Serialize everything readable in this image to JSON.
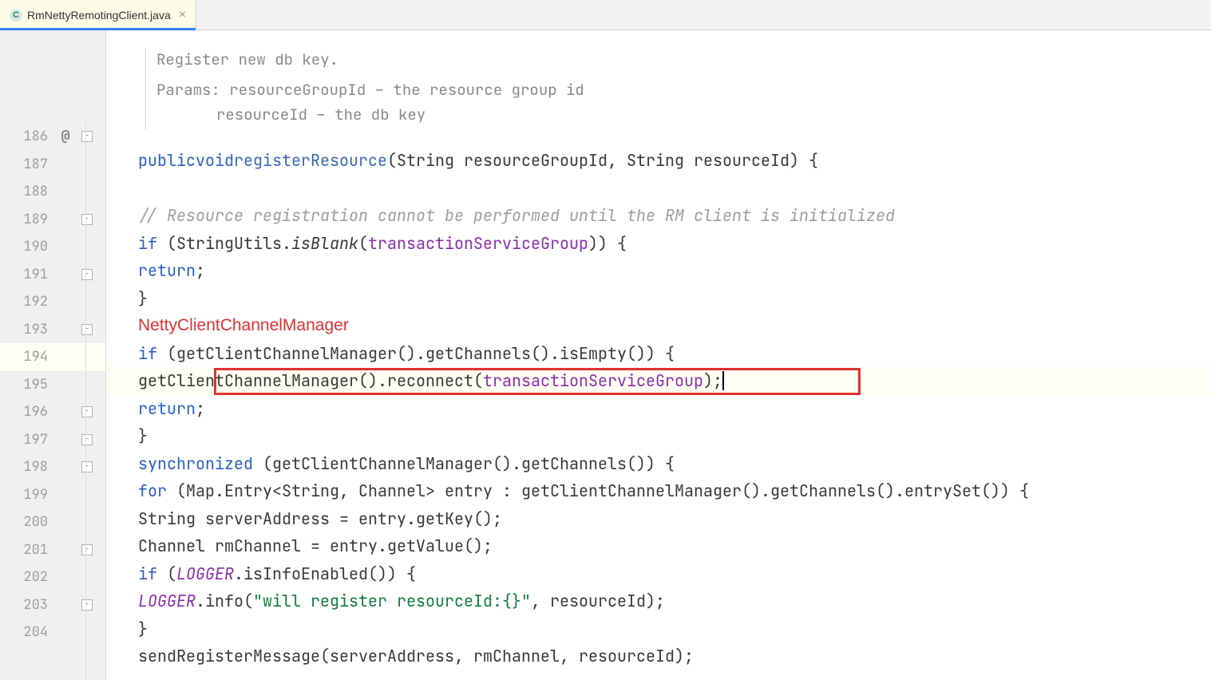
{
  "tab": {
    "icon_letter": "C",
    "filename": "RmNettyRemotingClient.java",
    "close_glyph": "×"
  },
  "javadoc": {
    "summary": "Register new db key.",
    "params_label": "Params:",
    "param1": "resourceGroupId – the resource group id",
    "param2": "resourceId – the db key"
  },
  "line_numbers": {
    "l186": "186",
    "l187": "187",
    "l188": "188",
    "l189": "189",
    "l190": "190",
    "l191": "191",
    "l192": "192",
    "l193": "193",
    "l194": "194",
    "l195": "195",
    "l196": "196",
    "l197": "197",
    "l198": "198",
    "l199": "199",
    "l200": "200",
    "l201": "201",
    "l202": "202",
    "l203": "203",
    "l204": "204"
  },
  "gutter": {
    "override_glyph": "@",
    "fold_minus": "−"
  },
  "annotation": {
    "red_label": "NettyClientChannelManager"
  },
  "code": {
    "l186": {
      "kw1": "public",
      "kw2": "void",
      "method": "registerResource",
      "sig": "(String resourceGroupId, String resourceId) {"
    },
    "l188_comment": "// Resource registration cannot be performed until the RM client is initialized",
    "l189": {
      "kw": "if",
      "pre": " (StringUtils.",
      "ital": "isBlank",
      "mid": "(",
      "field": "transactionServiceGroup",
      "post": ")) {"
    },
    "l190_return": "return",
    "l190_semi": ";",
    "l191_brace": "}",
    "l193": {
      "kw": "if",
      "body": " (getClientChannelManager().getChannels().isEmpty()) {"
    },
    "l194": {
      "pre": "getClientChannelManager().reconnect(",
      "field": "transactionServiceGroup",
      "post": ");"
    },
    "l195_return": "return",
    "l195_semi": ";",
    "l196_brace": "}",
    "l197": {
      "kw": "synchronized",
      "body": " (getClientChannelManager().getChannels()) {"
    },
    "l198": {
      "kw": "for",
      "body": " (Map.Entry<String, Channel> entry : getClientChannelManager().getChannels().entrySet()) {"
    },
    "l199": "String serverAddress = entry.getKey();",
    "l200": "Channel rmChannel = entry.getValue();",
    "l201": {
      "kw": "if",
      "pre": " (",
      "logger": "LOGGER",
      "post": ".isInfoEnabled()) {"
    },
    "l202": {
      "logger": "LOGGER",
      "pre": ".info(",
      "str": "\"will register resourceId:{}\"",
      "post": ", resourceId);"
    },
    "l203_brace": "}",
    "l204": "sendRegisterMessage(serverAddress, rmChannel, resourceId);"
  }
}
